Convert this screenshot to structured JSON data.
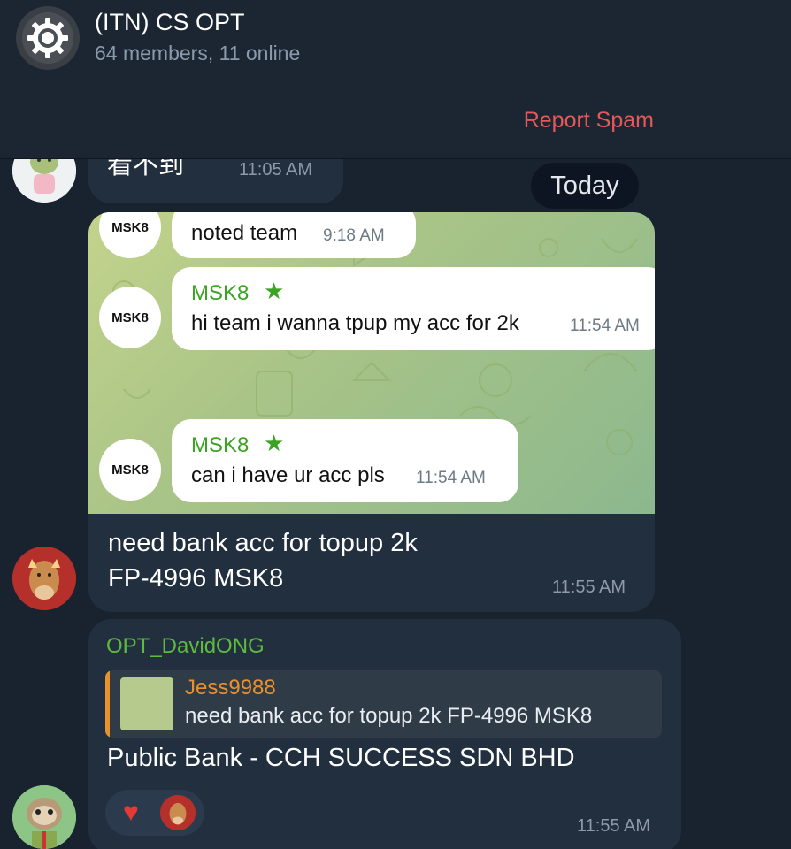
{
  "header": {
    "title": "(ITN) CS OPT",
    "subtitle": "64 members, 11 online",
    "avatar_icon": "gear-logo-icon"
  },
  "spam_bar": {
    "label": "Report Spam",
    "color": "#e5585a"
  },
  "chat": {
    "date_separator": "Today",
    "messages": [
      {
        "text": "看不到",
        "time": "11:05 AM"
      },
      {
        "screenshot": {
          "avatar_label": "MSK8",
          "messages": [
            {
              "text": "noted team",
              "time": "9:18 AM"
            },
            {
              "sender": "MSK8",
              "text": "hi team i wanna tpup my acc for 2k",
              "time": "11:54 AM"
            },
            {
              "sender": "MSK8",
              "text": "can i have ur acc pls",
              "time": "11:54 AM"
            }
          ]
        },
        "text_line1": "need bank acc for topup 2k",
        "text_line2": "FP-4996 MSK8",
        "time": "11:55 AM"
      },
      {
        "sender": "OPT_DavidONG",
        "reply": {
          "name": "Jess9988",
          "text": "need bank acc for topup 2k FP-4996 MSK8"
        },
        "text": "Public Bank - CCH SUCCESS SDN BHD",
        "time": "11:55 AM",
        "reactions": [
          "heart-icon",
          "horse-avatar-icon"
        ]
      }
    ]
  }
}
